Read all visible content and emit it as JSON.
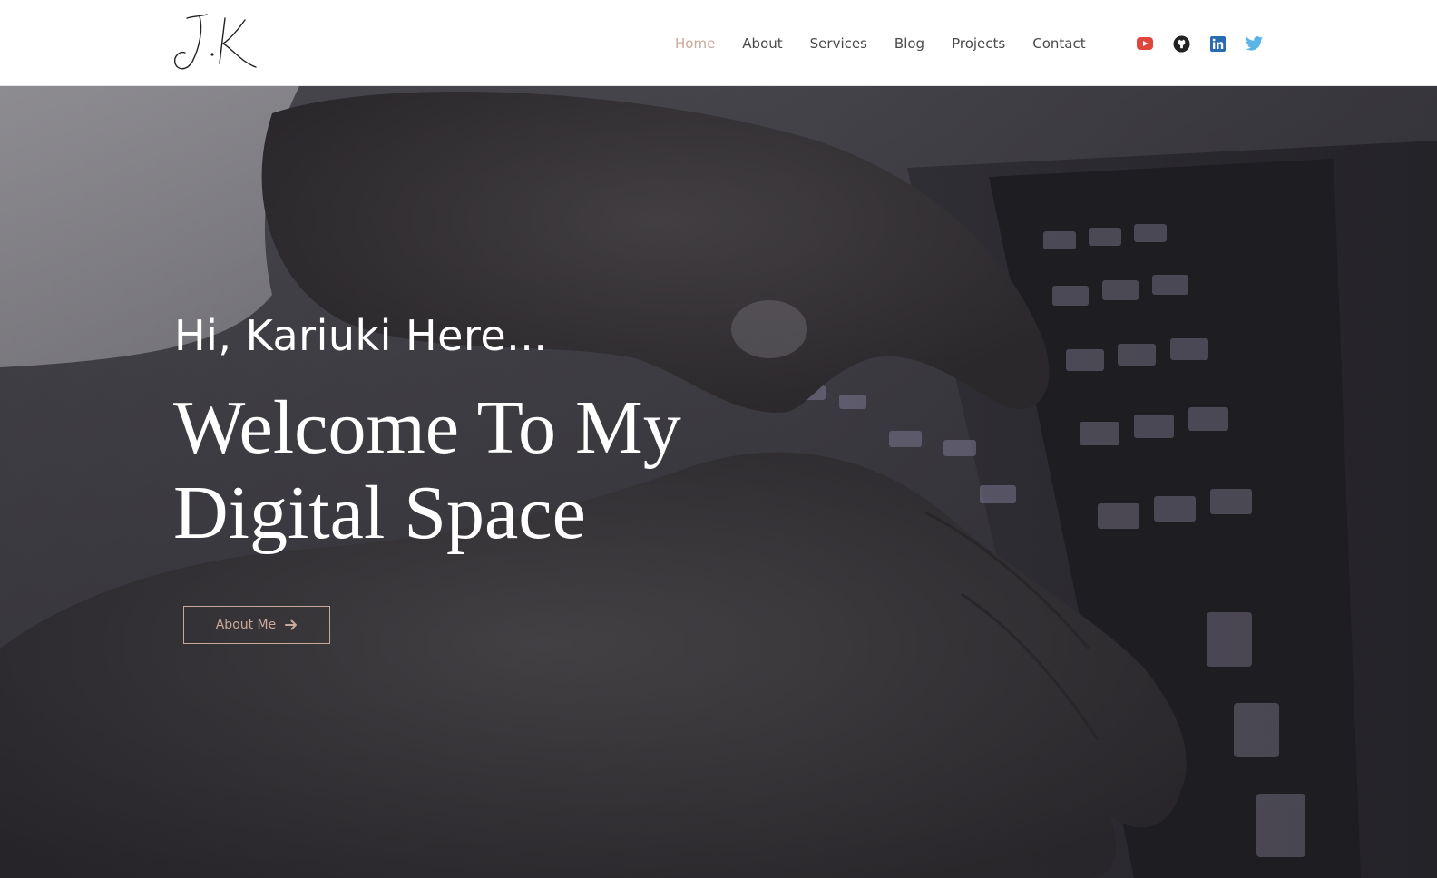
{
  "header": {
    "logo_text": "J.K",
    "nav": [
      {
        "label": "Home",
        "active": true
      },
      {
        "label": "About",
        "active": false
      },
      {
        "label": "Services",
        "active": false
      },
      {
        "label": "Blog",
        "active": false
      },
      {
        "label": "Projects",
        "active": false
      },
      {
        "label": "Contact",
        "active": false
      }
    ],
    "social": [
      {
        "name": "youtube-icon",
        "color": "#e0473c"
      },
      {
        "name": "github-icon",
        "color": "#222222"
      },
      {
        "name": "linkedin-icon",
        "color": "#2a6cb3"
      },
      {
        "name": "twitter-icon",
        "color": "#5ab4e6"
      }
    ]
  },
  "hero": {
    "greeting": "Hi, Kariuki Here...",
    "headline_line1": "Welcome To My",
    "headline_line2": "Digital Space",
    "cta_label": "About Me",
    "cta_icon": "arrow-right-icon",
    "background": "hands-typing-on-keyboard-photo"
  },
  "colors": {
    "accent": "#c8a99b",
    "nav_text": "#4a4a4a",
    "hero_text": "#ffffff"
  }
}
